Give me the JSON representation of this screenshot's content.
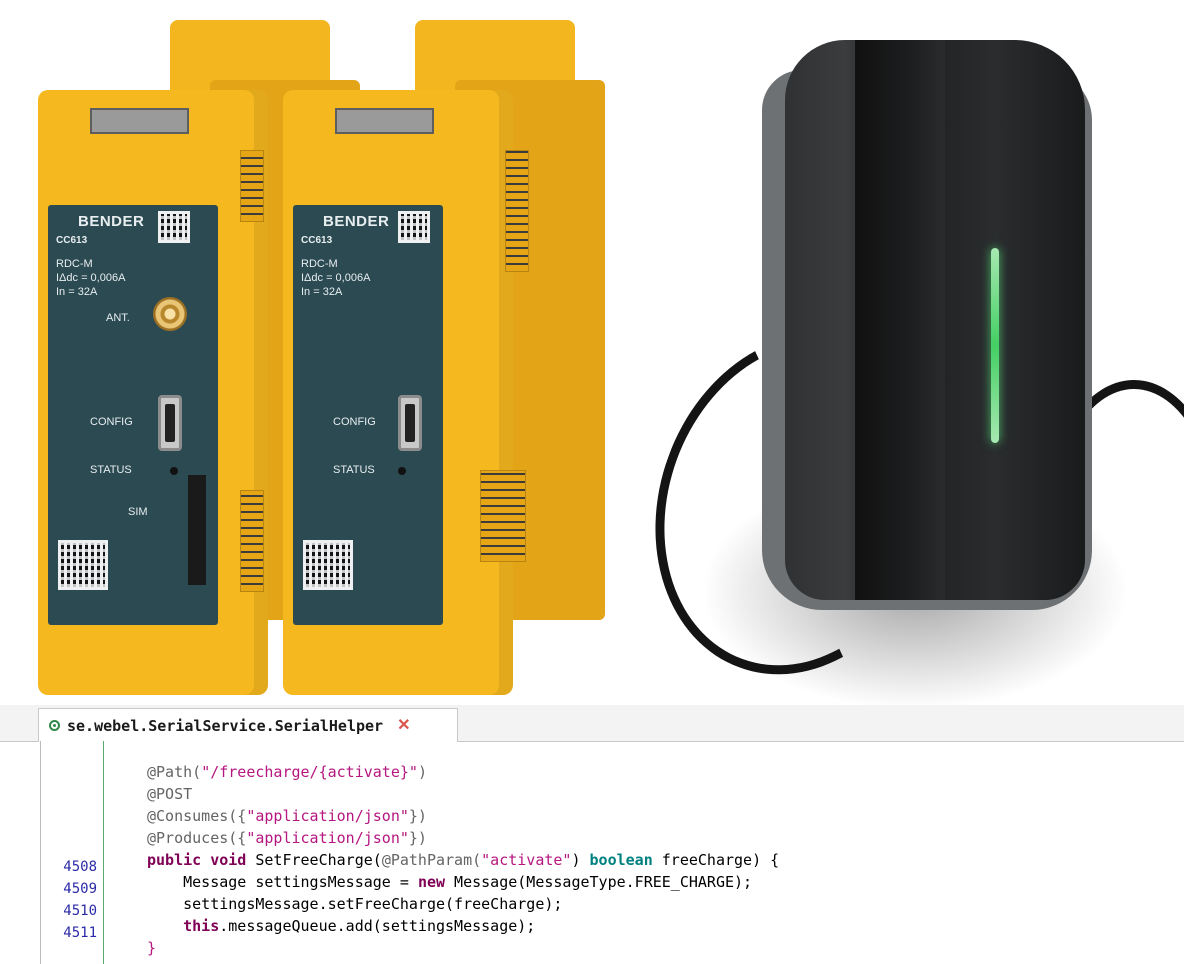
{
  "photo": {
    "modules": [
      {
        "brand": "BENDER",
        "model": "CC613",
        "spec_line1": "RDC-M",
        "spec_line2": "IΔdc = 0,006A",
        "spec_line3": "In = 32A",
        "ant_label": "ANT.",
        "config_label": "CONFIG",
        "status_label": "STATUS",
        "sim_label": "SIM"
      },
      {
        "brand": "BENDER",
        "model": "CC613",
        "spec_line1": "RDC-M",
        "spec_line2": "IΔdc = 0,006A",
        "spec_line3": "In = 32A",
        "config_label": "CONFIG",
        "status_label": "STATUS"
      }
    ],
    "charger_light_color": "#44cf63"
  },
  "editor": {
    "tab": {
      "icon": "class-icon",
      "title": "se.webel.SerialService.SerialHelper",
      "close_icon": "close-icon"
    },
    "line_numbers": [
      "",
      "",
      "",
      "",
      "4508",
      "4509",
      "4510",
      "4511",
      ""
    ],
    "code": {
      "l1_ann": "@Path(",
      "l1_str": "\"/freecharge/{activate}\"",
      "l1_end": ")",
      "l2_ann": "@POST",
      "l3_ann": "@Consumes({",
      "l3_str": "\"application/json\"",
      "l3_end": "})",
      "l4_ann": "@Produces({",
      "l4_str": "\"application/json\"",
      "l4_end": "})",
      "l5_kw": "public void",
      "l5_a": " SetFreeCharge(",
      "l5_ann": "@PathParam(",
      "l5_str": "\"activate\"",
      "l5_b": ") ",
      "l5_kw2": "boolean",
      "l5_c": " freeCharge) {",
      "l6_a": "    Message settingsMessage = ",
      "l6_kw": "new",
      "l6_b": " Message(MessageType.FREE_CHARGE);",
      "l7": "    settingsMessage.setFreeCharge(freeCharge);",
      "l8_kw": "this",
      "l8_b": ".messageQueue.add(settingsMessage);",
      "l9": "}"
    }
  }
}
